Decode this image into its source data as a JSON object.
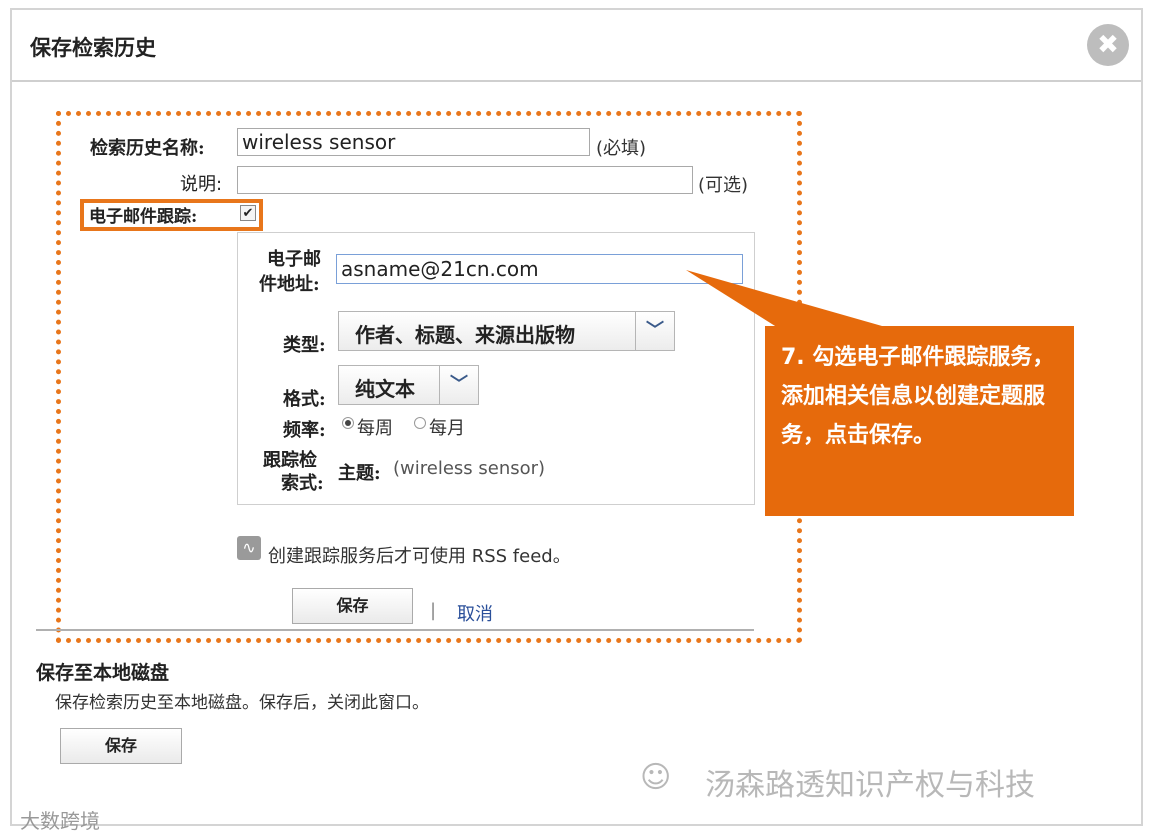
{
  "dialog": {
    "title": "保存检索历史",
    "close_icon": "✖"
  },
  "form": {
    "name_label": "检索历史名称:",
    "name_value": "wireless sensor",
    "name_hint": "(必填)",
    "desc_label": "说明:",
    "desc_value": "",
    "desc_hint": "(可选)",
    "email_track_label": "电子邮件跟踪:",
    "email_track_checked": true
  },
  "tracking": {
    "email_label_line1": "电子邮",
    "email_label_line2": "件地址:",
    "email_value": "asname@21cn.com",
    "type_label": "类型:",
    "type_value": "作者、标题、来源出版物",
    "format_label": "格式:",
    "format_value": "纯文本",
    "freq_label": "频率:",
    "freq_weekly": "每周",
    "freq_monthly": "每月",
    "freq_selected": "每周",
    "expr_label_line1": "跟踪检",
    "expr_label_line2": "索式:",
    "expr_topic_label": "主题:",
    "expr_value": "(wireless sensor)"
  },
  "rss_note": "创建跟踪服务后才可使用 RSS feed。",
  "actions": {
    "save": "保存",
    "separator": "|",
    "cancel": "取消"
  },
  "local_save": {
    "heading": "保存至本地磁盘",
    "desc": "保存检索历史至本地磁盘。保存后，关闭此窗口。",
    "save": "保存"
  },
  "callout": {
    "text": "7. 勾选电子邮件跟踪服务，添加相关信息以创建定题服务，点击保存。"
  },
  "watermarks": {
    "right": "汤森路透知识产权与科技",
    "left": "大数跨境"
  },
  "colors": {
    "accent": "#e8761b",
    "callout_bg": "#e66a0c",
    "link": "#2a4f9a"
  }
}
